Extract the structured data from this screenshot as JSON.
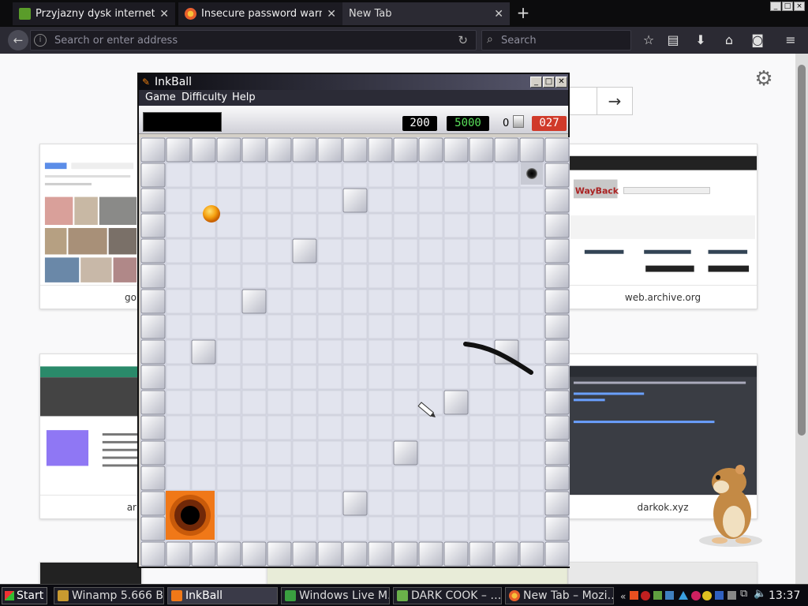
{
  "browser": {
    "tabs": [
      {
        "title": "Przyjazny dysk interneto…",
        "favicon": "green-disk-icon",
        "active": false
      },
      {
        "title": "Insecure password warni…",
        "favicon": "firefox-icon",
        "active": false
      },
      {
        "title": "New Tab",
        "favicon": "",
        "active": true
      }
    ],
    "window_buttons": [
      "_",
      "□",
      "×"
    ],
    "address_placeholder": "Search or enter address",
    "search_placeholder": "Search",
    "toolbar_icons": [
      "bookmark-star-icon",
      "library-icon",
      "download-icon",
      "home-icon",
      "pocket-icon",
      "menu-icon"
    ]
  },
  "newtab": {
    "tiles": [
      {
        "caption": "go",
        "name": "google-images-tile"
      },
      {
        "caption": "web.archive.org",
        "name": "web-archive-tile"
      },
      {
        "caption": "ar",
        "name": "archive-org-tile"
      },
      {
        "caption": "darkok.xyz",
        "name": "darkok-tile"
      }
    ],
    "go_arrow": "→"
  },
  "inkball": {
    "title": "InkBall",
    "menu": [
      "Game",
      "Difficulty",
      "Help"
    ],
    "score": "200",
    "bonus": "5000",
    "balls_count": "0",
    "time": "027",
    "colors": {
      "score_bg": "#000000",
      "score_fg": "#ffffff",
      "bonus_fg": "#59e05a",
      "time_bg": "#d03a2a",
      "orange": "#f07818",
      "tile": "#e2e4ee"
    }
  },
  "taskbar": {
    "start_label": "Start",
    "tasks": [
      {
        "label": "Winamp 5.666 B…",
        "icon": "winamp-icon",
        "active": false
      },
      {
        "label": "InkBall",
        "icon": "inkball-icon",
        "active": true
      },
      {
        "label": "Windows Live M…",
        "icon": "messenger-icon",
        "active": false
      },
      {
        "label": "DARK COOK – …",
        "icon": "dark-cook-icon",
        "active": false
      },
      {
        "label": "New Tab – Mozi…",
        "icon": "firefox-icon",
        "active": false
      }
    ],
    "clock": "13:37"
  }
}
